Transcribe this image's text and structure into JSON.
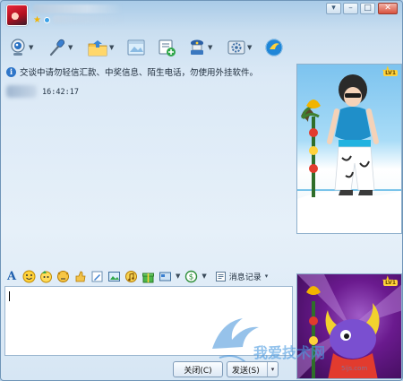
{
  "window": {
    "buttons": {
      "menu": "▾",
      "minimize": "–",
      "maximize": "□",
      "close": "✕"
    }
  },
  "toolbar": {
    "items": [
      {
        "icon": "webcam-icon",
        "has_dropdown": true
      },
      {
        "icon": "microphone-icon",
        "has_dropdown": true
      },
      {
        "icon": "send-file-icon",
        "has_dropdown": true
      },
      {
        "icon": "image-icon",
        "has_dropdown": false
      },
      {
        "icon": "create-group-icon",
        "has_dropdown": false
      },
      {
        "icon": "remote-assist-icon",
        "has_dropdown": true
      },
      {
        "icon": "settings-icon",
        "has_dropdown": true
      },
      {
        "icon": "app-icon",
        "has_dropdown": false
      }
    ]
  },
  "warning": {
    "text": "交谈中请勿轻信汇款、中奖信息、陌生电话，勿使用外挂软件。"
  },
  "chat": {
    "messages": [
      {
        "time": "16:42:17"
      }
    ]
  },
  "show_panel": {
    "level_badge": "LV1"
  },
  "input_toolbar": {
    "font_label": "A",
    "history_label": "消息记录",
    "history_dropdown": "▾"
  },
  "footer": {
    "close_label": "关闭(C)",
    "send_label": "发送(S)",
    "send_dropdown": "▾"
  },
  "watermark": {
    "text": "我爱技术网",
    "subtext": "5ijs.com"
  },
  "colors": {
    "accent": "#2f76c9",
    "window_bg": "#dbe9f6",
    "close_red": "#d9523e"
  }
}
